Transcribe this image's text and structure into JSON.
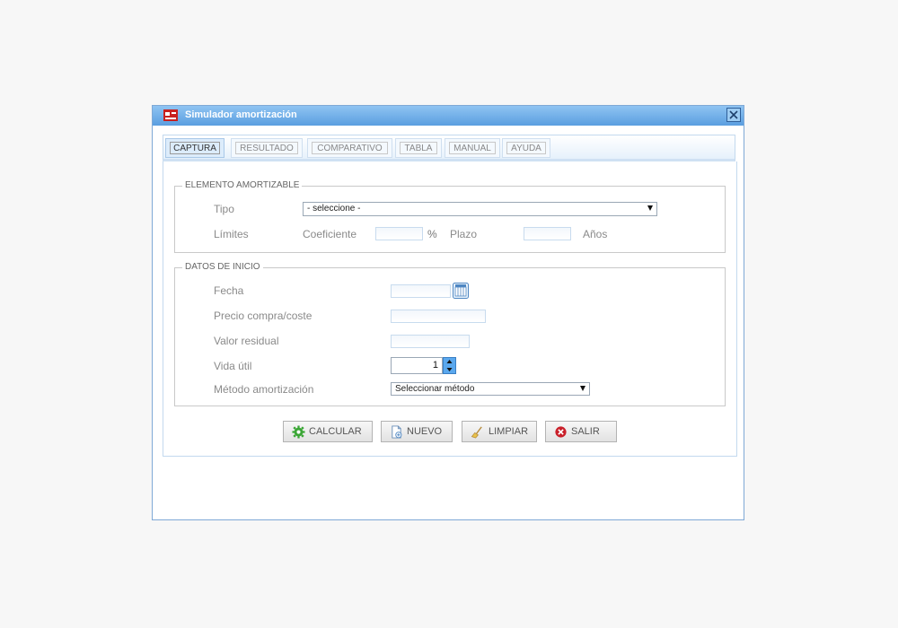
{
  "window": {
    "title": "Simulador amortización"
  },
  "tabs": [
    {
      "label": "CAPTURA",
      "active": true
    },
    {
      "label": "RESULTADO",
      "active": false
    },
    {
      "label": "COMPARATIVO",
      "active": false
    },
    {
      "label": "TABLA",
      "active": false
    },
    {
      "label": "MANUAL",
      "active": false
    },
    {
      "label": "AYUDA",
      "active": false
    }
  ],
  "elemento": {
    "legend": "ELEMENTO AMORTIZABLE",
    "tipo_label": "Tipo",
    "tipo_value": "- seleccione -",
    "limites_label": "Límites",
    "coeficiente_label": "Coeficiente",
    "coeficiente_value": "",
    "percent": "%",
    "plazo_label": "Plazo",
    "plazo_value": "",
    "anios": "Años"
  },
  "datos": {
    "legend": "DATOS DE INICIO",
    "fecha_label": "Fecha",
    "fecha_value": "",
    "precio_label": "Precio compra/coste",
    "precio_value": "",
    "residual_label": "Valor residual",
    "residual_value": "",
    "vida_label": "Vida útil",
    "vida_value": "1",
    "metodo_label": "Método amortización",
    "metodo_value": "Seleccionar método"
  },
  "buttons": {
    "calcular": "CALCULAR",
    "nuevo": "NUEVO",
    "limpiar": "LIMPIAR",
    "salir": "SALIR"
  },
  "colors": {
    "titlebar": "#5a9ee0",
    "calcular_icon": "#3aa635",
    "salir_icon": "#c9202a"
  }
}
